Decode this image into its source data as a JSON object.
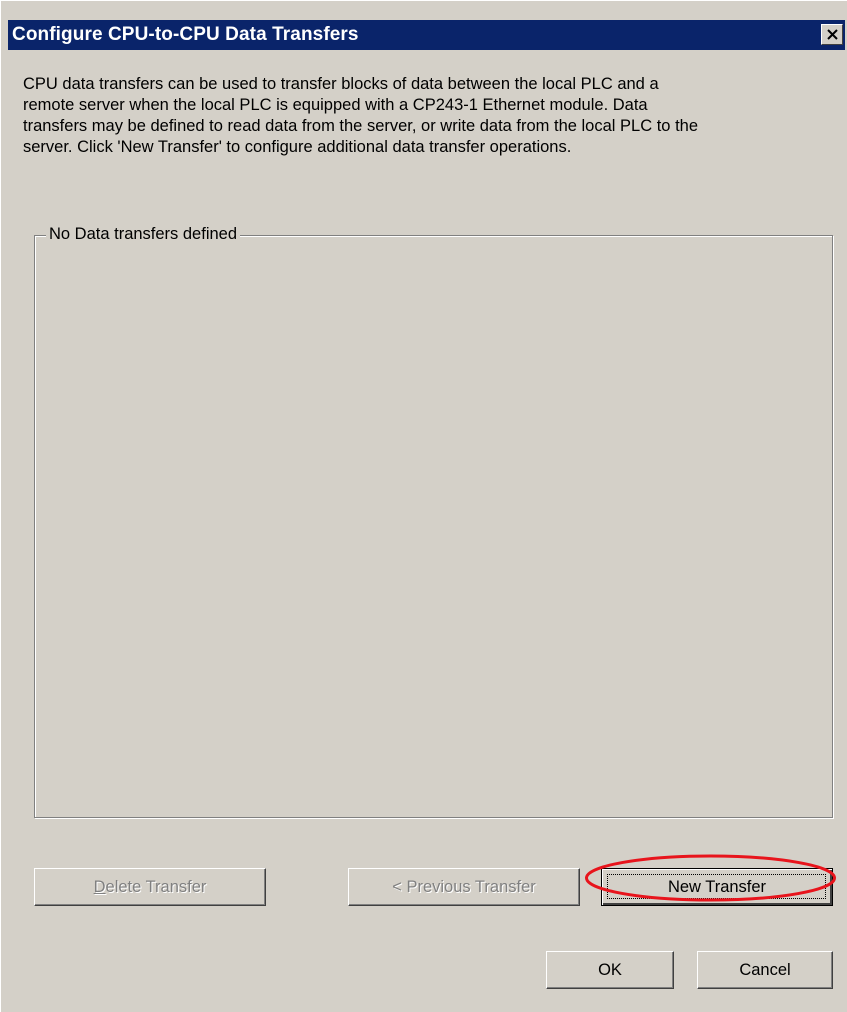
{
  "window": {
    "title": "Configure CPU-to-CPU Data Transfers",
    "close_icon": "close-icon"
  },
  "description": {
    "lines": [
      "CPU data transfers can be used to transfer blocks of data between the local PLC and a",
      "remote server when the local PLC is equipped with a CP243-1 Ethernet module. Data",
      "transfers may be defined to read data from the server, or write data from the local PLC to the",
      "server. Click 'New Transfer' to configure additional data transfer operations."
    ]
  },
  "transfers_group": {
    "label": "No Data transfers defined"
  },
  "buttons": {
    "delete_transfer": "Delete Transfer",
    "previous_transfer": "< Previous Transfer",
    "new_transfer": "New Transfer",
    "ok": "OK",
    "cancel": "Cancel"
  },
  "annotation": {
    "highlight_color": "#e8141c"
  }
}
